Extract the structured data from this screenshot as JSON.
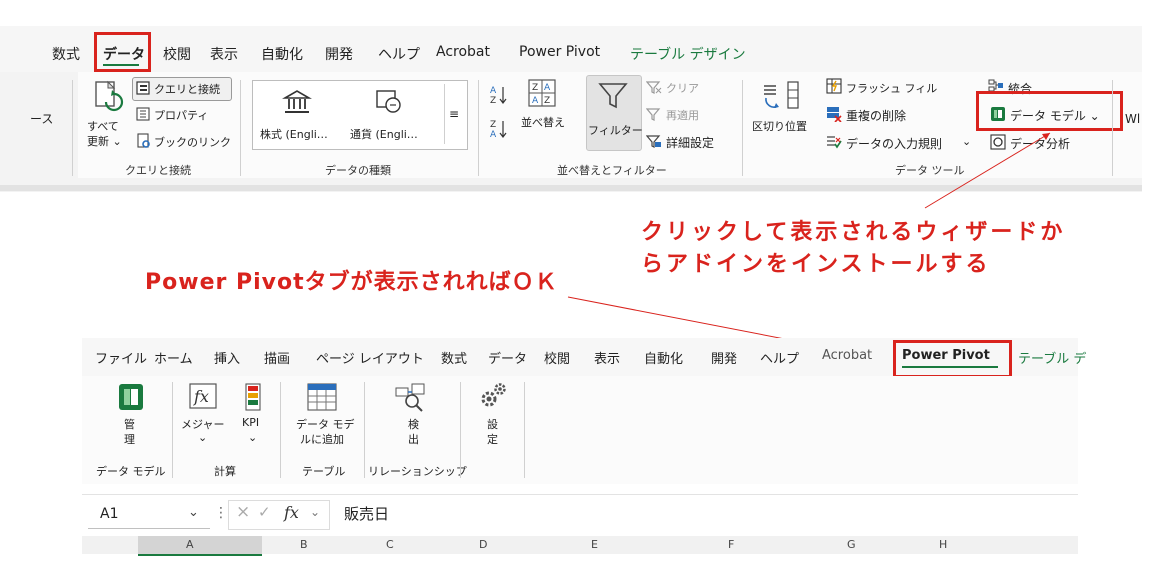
{
  "top_ribbon": {
    "tabs": [
      "数式",
      "データ",
      "校閲",
      "表示",
      "自動化",
      "開発",
      "ヘルプ",
      "Acrobat",
      "Power Pivot",
      "テーブル デザイン"
    ],
    "left_cut_label": "ース",
    "queries": {
      "refresh_line1": "すべて",
      "refresh_line2": "更新 ⌄",
      "items": [
        "クエリと接続",
        "プロパティ",
        "ブックのリンク"
      ],
      "group_label": "クエリと接続"
    },
    "data_types": {
      "items": [
        "株式 (Engli…",
        "通貨 (Engli…"
      ],
      "group_label": "データの種類"
    },
    "sort_filter": {
      "sort": "並べ替え",
      "filter": "フィルター",
      "items": [
        "クリア",
        "再適用",
        "詳細設定"
      ],
      "group_label": "並べ替えとフィルター"
    },
    "data_tools": {
      "text_to_columns": "区切り位置",
      "items": [
        "フラッシュ フィル",
        "重複の削除",
        "データの入力規則"
      ],
      "items2": [
        "統合",
        "データ モデル ⌄",
        "データ分析"
      ],
      "group_label": "データ ツール",
      "right_cut": "Wl"
    }
  },
  "annotations": {
    "right_line1": "クリックして表示されるウィザードか",
    "right_line2": "らアドインをインストールする",
    "left": "Power Pivotタブが表示されればＯＫ"
  },
  "bottom_ribbon": {
    "tabs": [
      "ファイル",
      "ホーム",
      "挿入",
      "描画",
      "ページ レイアウト",
      "数式",
      "データ",
      "校閲",
      "表示",
      "自動化",
      "開発",
      "ヘルプ",
      "Acrobat",
      "Power Pivot",
      "テーブル デ"
    ],
    "manage": {
      "line1": "管",
      "line2": "理",
      "group_label": "データ モデル"
    },
    "calc": {
      "measure": "メジャー",
      "kpi": "KPI",
      "group_label": "計算"
    },
    "table": {
      "line1": "データ モデ",
      "line2": "ルに追加",
      "group_label": "テーブル"
    },
    "relations": {
      "line1": "検",
      "line2": "出",
      "group_label": "リレーションシップ"
    },
    "settings": {
      "line1": "設",
      "line2": "定"
    }
  },
  "formula_bar": {
    "name_box": "A1",
    "fx": "fx",
    "content": "販売日"
  },
  "columns": [
    "A",
    "B",
    "C",
    "D",
    "E",
    "F",
    "G",
    "H"
  ],
  "colors": {
    "accent_red": "#d9231d",
    "excel_green": "#1a7a3f"
  }
}
